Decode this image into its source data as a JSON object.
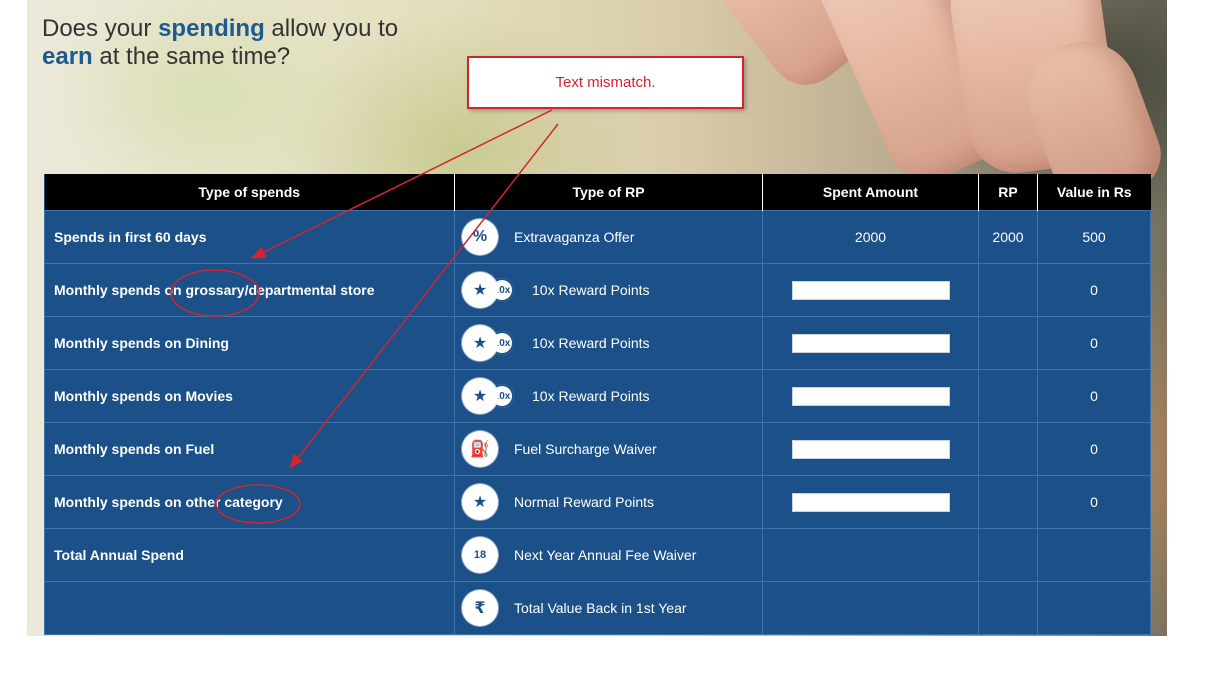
{
  "headline": {
    "part1": "Does your ",
    "emph1": "spending",
    "part2": " allow you to",
    "emph2": "earn",
    "part3": " at the same time?"
  },
  "callout": {
    "text": "Text mismatch."
  },
  "table": {
    "headers": [
      "Type of spends",
      "Type of RP",
      "Spent Amount",
      "RP",
      "Value in Rs"
    ],
    "rows": [
      {
        "label": "Spends in first 60 days",
        "icon": "percent-icon",
        "icon_glyph": "%",
        "rp_type": "Extravaganza Offer",
        "spent": "2000",
        "rp": "2000",
        "value": "500"
      },
      {
        "label": "Monthly spends on grossary/departmental store",
        "icon": "star-10x-icon",
        "icon_glyph": "★",
        "pill": "10x",
        "rp_type": "10x Reward Points",
        "spent_input": "",
        "rp": "",
        "value": "0"
      },
      {
        "label": "Monthly spends on Dining",
        "icon": "star-10x-icon",
        "icon_glyph": "★",
        "pill": "10x",
        "rp_type": "10x Reward Points",
        "spent_input": "",
        "rp": "",
        "value": "0"
      },
      {
        "label": "Monthly spends on Movies",
        "icon": "star-10x-icon",
        "icon_glyph": "★",
        "pill": "10x",
        "rp_type": "10x Reward Points",
        "spent_input": "",
        "rp": "",
        "value": "0"
      },
      {
        "label": "Monthly spends on Fuel",
        "icon": "fuel-pump-icon",
        "icon_glyph": "⛽",
        "rp_type": "Fuel Surcharge Waiver",
        "spent_input": "",
        "rp": "",
        "value": "0"
      },
      {
        "label": "Monthly spends on other category",
        "icon": "star-icon",
        "icon_glyph": "★",
        "rp_type": "Normal Reward Points",
        "spent_input": "",
        "rp": "",
        "value": "0"
      },
      {
        "label": "Total Annual Spend",
        "icon": "calendar-icon",
        "icon_glyph": "18",
        "rp_type": "Next Year Annual Fee Waiver",
        "spent": "",
        "rp": "",
        "value": ""
      },
      {
        "label": "",
        "icon": "rupee-icon",
        "icon_glyph": "₹",
        "rp_type": "Total Value Back in 1st Year",
        "spent": "",
        "rp": "",
        "value": ""
      }
    ]
  },
  "colors": {
    "table_bg": "#1b5188",
    "header_bg": "#000000",
    "headline_accent": "#1c5a90",
    "annotation_red": "#d3242f"
  }
}
